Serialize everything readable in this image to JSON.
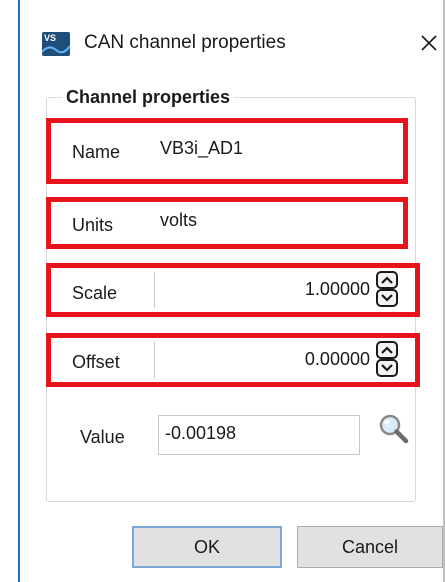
{
  "window": {
    "title": "CAN channel properties",
    "app_icon_text": "VS",
    "close_glyph": "✕"
  },
  "group": {
    "title": "Channel properties"
  },
  "fields": {
    "name": {
      "label": "Name",
      "value": "VB3i_AD1"
    },
    "units": {
      "label": "Units",
      "value": "volts"
    },
    "scale": {
      "label": "Scale",
      "value": "1.00000"
    },
    "offset": {
      "label": "Offset",
      "value": "0.00000"
    },
    "value": {
      "label": "Value",
      "value": "-0.00198"
    }
  },
  "buttons": {
    "ok": "OK",
    "cancel": "Cancel"
  },
  "icons": {
    "app": "vbox-app-icon",
    "close": "close-icon",
    "spin_up": "chevron-up-icon",
    "spin_down": "chevron-down-icon",
    "zoom": "magnifier-icon"
  },
  "colors": {
    "highlight": "#e8141b",
    "accent": "#1f6fb5",
    "button_face": "#e1e1e1",
    "default_button_border": "#7aa7d6"
  }
}
